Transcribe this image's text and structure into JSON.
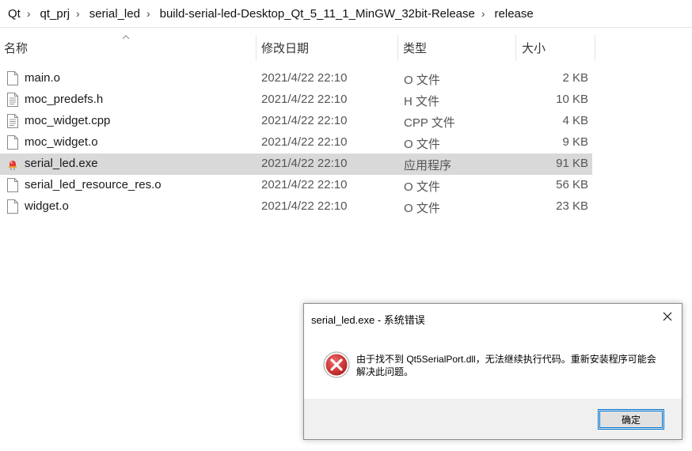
{
  "breadcrumb": [
    "Qt",
    "qt_prj",
    "serial_led",
    "build-serial-led-Desktop_Qt_5_11_1_MinGW_32bit-Release",
    "release"
  ],
  "columns": {
    "name": "名称",
    "date": "修改日期",
    "type": "类型",
    "size": "大小"
  },
  "files": [
    {
      "name": "main.o",
      "date": "2021/4/22 22:10",
      "type": "O 文件",
      "size": "2 KB",
      "icon": "blank-file-icon"
    },
    {
      "name": "moc_predefs.h",
      "date": "2021/4/22 22:10",
      "type": "H 文件",
      "size": "10 KB",
      "icon": "text-file-icon"
    },
    {
      "name": "moc_widget.cpp",
      "date": "2021/4/22 22:10",
      "type": "CPP 文件",
      "size": "4 KB",
      "icon": "text-file-icon"
    },
    {
      "name": "moc_widget.o",
      "date": "2021/4/22 22:10",
      "type": "O 文件",
      "size": "9 KB",
      "icon": "blank-file-icon"
    },
    {
      "name": "serial_led.exe",
      "date": "2021/4/22 22:10",
      "type": "应用程序",
      "size": "91 KB",
      "icon": "led-app-icon",
      "selected": true
    },
    {
      "name": "serial_led_resource_res.o",
      "date": "2021/4/22 22:10",
      "type": "O 文件",
      "size": "56 KB",
      "icon": "blank-file-icon"
    },
    {
      "name": "widget.o",
      "date": "2021/4/22 22:10",
      "type": "O 文件",
      "size": "23 KB",
      "icon": "blank-file-icon"
    }
  ],
  "dialog": {
    "title": "serial_led.exe - 系统错误",
    "message": "由于找不到 Qt5SerialPort.dll，无法继续执行代码。重新安装程序可能会解决此问题。",
    "ok_label": "确定",
    "icon": "error-icon"
  },
  "colors": {
    "selected_row": "#d9d9d9",
    "error_red": "#d32f2f",
    "button_focus": "#0078d7"
  }
}
